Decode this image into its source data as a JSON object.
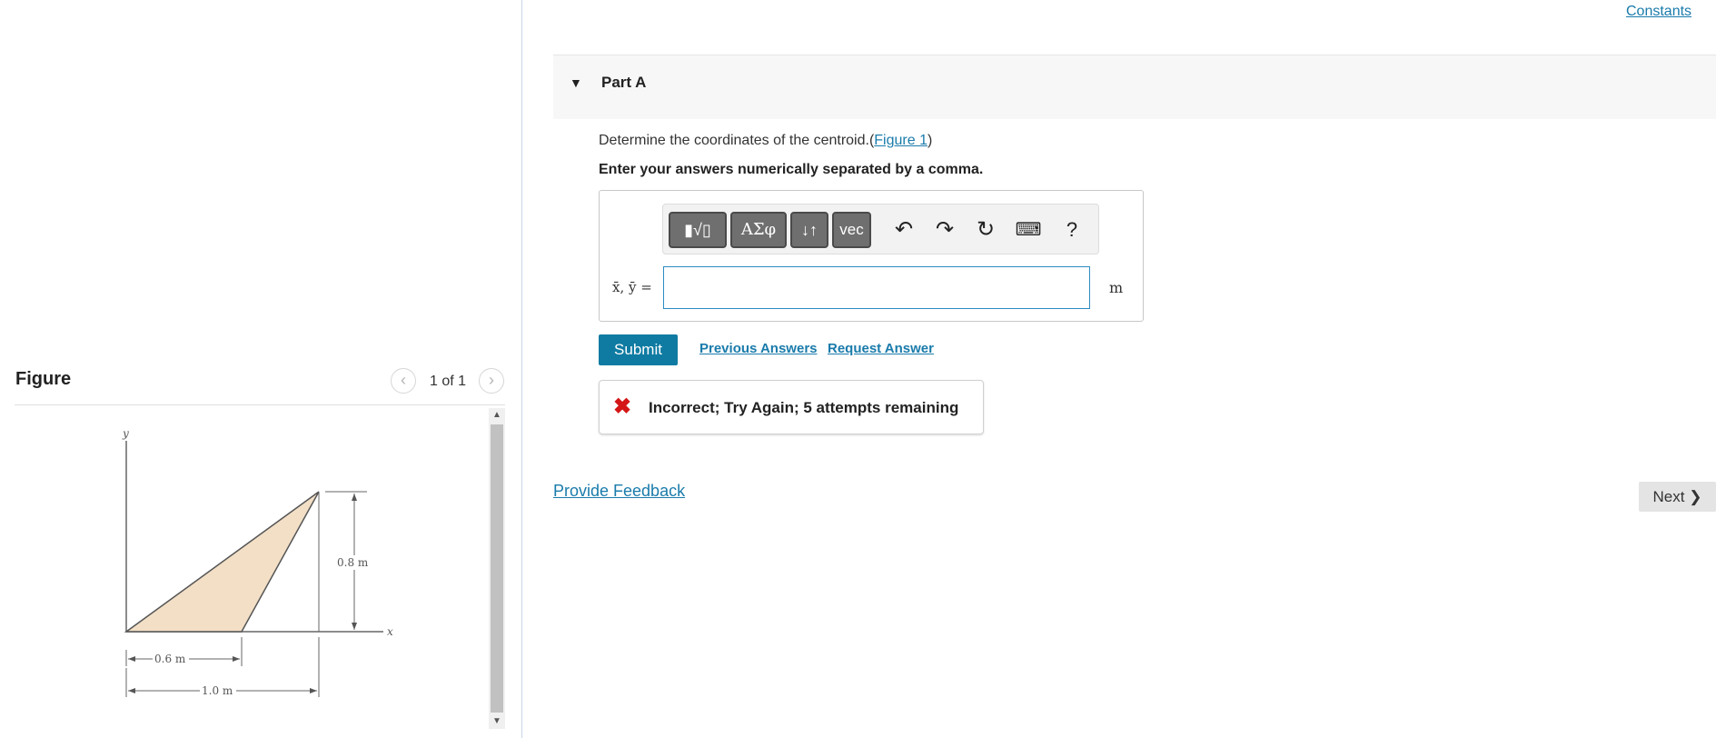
{
  "header": {
    "constants_link": "Constants"
  },
  "figure_panel": {
    "title": "Figure",
    "pager": {
      "count": "1 of 1",
      "prev_icon": "‹",
      "next_icon": "›"
    },
    "diagram": {
      "y_axis_label": "y",
      "x_axis_label": "x",
      "height_label": "0.8 m",
      "base_label": "0.6 m",
      "width_label": "1.0 m"
    },
    "scrollbar": {
      "up_icon": "▲",
      "down_icon": "▼"
    }
  },
  "part": {
    "caret_icon": "▼",
    "title": "Part A"
  },
  "question": {
    "text": "Determine the coordinates of the centroid.(",
    "figure_link": "Figure 1",
    "text_end": ")",
    "instruction": "Enter your answers numerically separated by a comma."
  },
  "toolbar": {
    "templates_label": "▮√▯",
    "symbols_label": "ΑΣφ",
    "arrows_label": "↓↑",
    "vec_label": "vec",
    "undo_icon": "↶",
    "redo_icon": "↷",
    "reset_icon": "↻",
    "keyboard_icon": "⌨",
    "help_label": "?"
  },
  "answer": {
    "variable_label": "x̄, ȳ =",
    "value": "",
    "unit": "m"
  },
  "actions": {
    "submit_label": "Submit",
    "previous_answers_label": "Previous Answers",
    "request_answer_label": "Request Answer"
  },
  "feedback": {
    "icon": "✖",
    "message": "Incorrect; Try Again; 5 attempts remaining",
    "status_color": "#d41616"
  },
  "footer": {
    "provide_feedback_label": "Provide Feedback",
    "next_label": "Next ❯"
  },
  "colors": {
    "accent": "#0f7ba2",
    "link": "#1a7bab",
    "triangle_fill": "#f2dfc6"
  }
}
